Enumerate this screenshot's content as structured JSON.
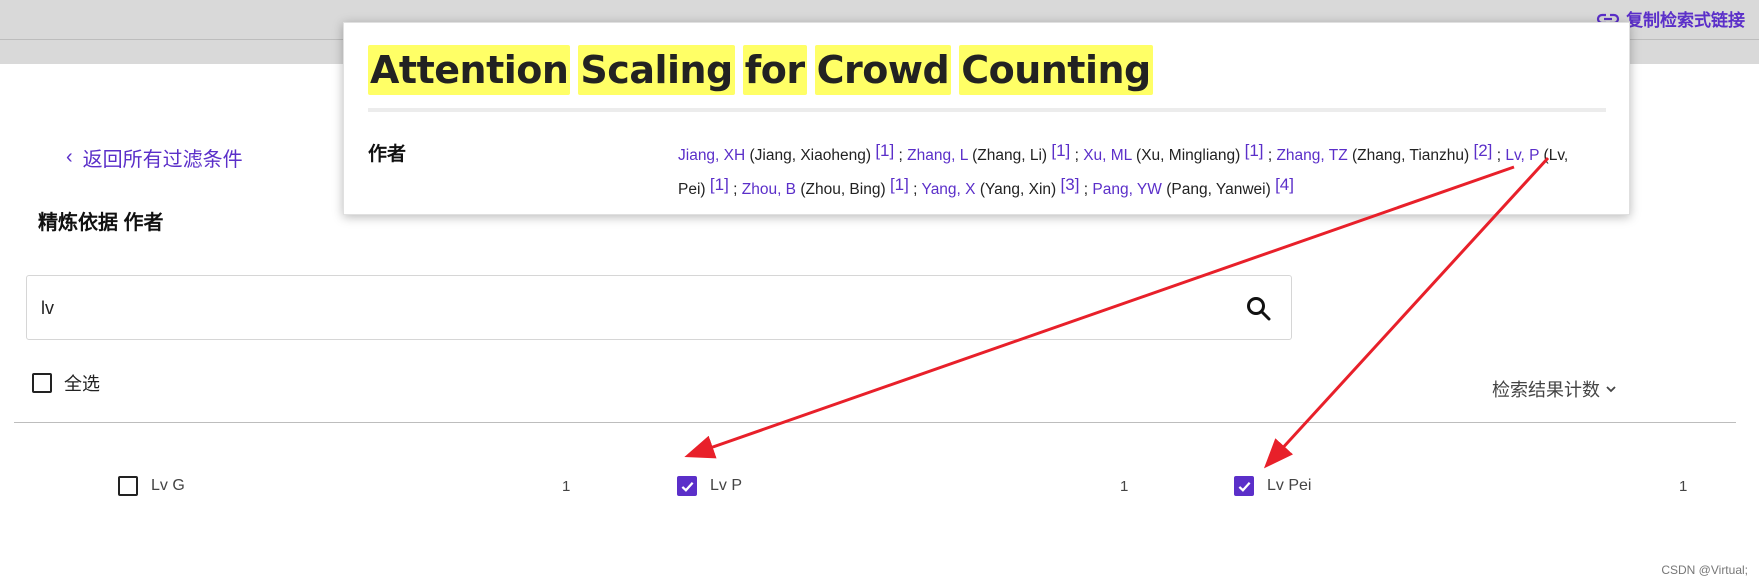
{
  "toolbar": {
    "copy_link_label": "复制检索式链接",
    "copy_link_icon": "link-icon"
  },
  "filters": {
    "back_label": "返回所有过滤条件",
    "refine_title": "精炼依据 作者",
    "search": {
      "value": "lv",
      "icon": "search-icon"
    },
    "select_all_label": "全选",
    "sort_label": "检索结果计数"
  },
  "results": [
    {
      "name": "Lv G",
      "count": "1",
      "checked": false
    },
    {
      "name": "Lv P",
      "count": "1",
      "checked": true
    },
    {
      "name": "Lv Pei",
      "count": "1",
      "checked": true
    }
  ],
  "popup": {
    "title_words": [
      "Attention",
      "Scaling",
      "for",
      "Crowd",
      "Counting"
    ],
    "authors_label": "作者",
    "authors": [
      {
        "short": "Jiang, XH",
        "full": "(Jiang, Xiaoheng)",
        "ref": "[1]"
      },
      {
        "short": "Zhang, L",
        "full": "(Zhang, Li)",
        "ref": "[1]"
      },
      {
        "short": "Xu, ML",
        "full": "(Xu, Mingliang)",
        "ref": "[1]"
      },
      {
        "short": "Zhang, TZ",
        "full": "(Zhang, Tianzhu)",
        "ref": "[2]"
      },
      {
        "short": "Lv, P",
        "full": "(Lv, Pei)",
        "ref": "[1]"
      },
      {
        "short": "Zhou, B",
        "full": "(Zhou, Bing)",
        "ref": "[1]"
      },
      {
        "short": "Yang, X",
        "full": "(Yang, Xin)",
        "ref": "[3]"
      },
      {
        "short": "Pang, YW",
        "full": "(Pang, Yanwei)",
        "ref": "[4]"
      }
    ],
    "separator": ";"
  },
  "colors": {
    "accent": "#5b2fc9",
    "highlight": "#ffff66",
    "annotation_arrow": "#e8202a"
  },
  "watermark": "CSDN @Virtual;"
}
